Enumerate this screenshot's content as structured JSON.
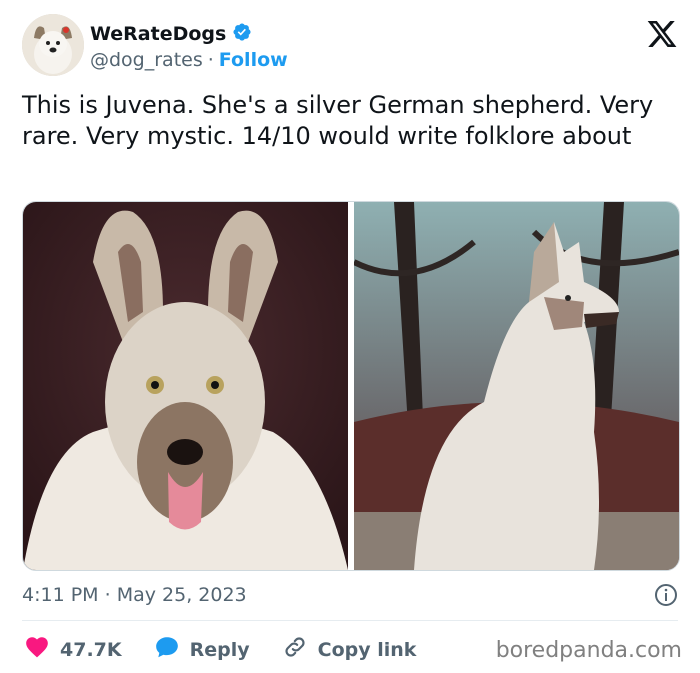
{
  "account": {
    "display_name": "WeRateDogs",
    "handle": "@dog_rates",
    "separator": "·",
    "follow_label": "Follow",
    "verified_color": "#1d9bf0"
  },
  "tweet": {
    "text": "This is Juvena. She's a silver German shepherd. Very rare. Very mystic. 14/10 would write folklore about",
    "time": "4:11 PM",
    "separator": "·",
    "date": "May 25, 2023"
  },
  "actions": {
    "likes_count": "47.7K",
    "reply_label": "Reply",
    "copy_link_label": "Copy link",
    "like_color": "#f91880",
    "reply_color": "#1d9bf0"
  },
  "icons": [
    "verified-badge-icon",
    "x-logo-icon",
    "info-icon",
    "heart-icon",
    "reply-bubble-icon",
    "link-icon"
  ],
  "watermark": "boredpanda.com"
}
